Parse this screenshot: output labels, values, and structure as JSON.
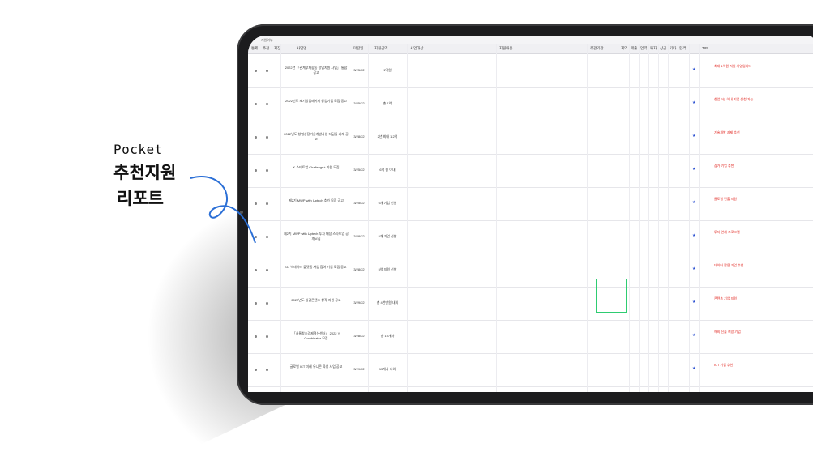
{
  "callout": {
    "line1": "Pocket",
    "line2": "추천지원",
    "line3": "리포트"
  },
  "table": {
    "top_header": "지원여부",
    "columns": [
      "통제",
      "추천",
      "저장",
      "사업명",
      "마감일",
      "지원금액",
      "사업대상",
      "지원내용",
      "주관기관",
      "지역",
      "매출",
      "업력",
      "투자",
      "상금",
      "기타",
      "합격",
      "TIP"
    ],
    "rows": [
      {
        "title": "2022년 「관계부처합동 창업지원 사업」 통합 공고",
        "date": "3/25/22",
        "amount": "1억원",
        "tip": "최대 1억원 지원 사업입니다"
      },
      {
        "title": "2022년도 초기창업패키지 창업기업 모집 공고",
        "date": "3/25/22",
        "amount": "총 1억",
        "tip": "창업 3년 이내 기업 신청 가능"
      },
      {
        "title": "2022년도 창업성장기술개발사업 디딤돌 과제 공고",
        "date": "3/28/22",
        "amount": "2년 최대 1.2억",
        "tip": "기술개발 과제 추천"
      },
      {
        "title": "K-스타트업 Challenge+ 지원 모집",
        "date": "3/25/22",
        "amount": "6억 원 이내",
        "tip": "참가 기업 추천"
      },
      {
        "title": "제2기 MWP with Uptech 추가 모집 공고",
        "date": "3/25/22",
        "amount": "6개 기업 선발",
        "tip": "글로벌 진출 지원"
      },
      {
        "title": "제2기 MWP with Uptech 투자 대상 스타트업 공개모집",
        "date": "3/28/22",
        "amount": "5개 기업 선발",
        "tip": "투자 연계 프로그램"
      },
      {
        "title": "DJ 빅데이터 플랫폼 사업 참여 기업 모집 공고",
        "date": "3/28/22",
        "amount": "5억 지원 선발",
        "tip": "데이터 활용 기업 추천"
      },
      {
        "title": "2022년도 실감콘텐츠 창작 지원 공고",
        "date": "3/29/22",
        "amount": "총 4천만원 내외",
        "tip": "콘텐츠 기업 지원"
      },
      {
        "title": "「서울창조경제혁신센터」 2022 Y Combinator 모집",
        "date": "3/28/22",
        "amount": "총 10개사",
        "tip": "해외 진출 희망 기업"
      },
      {
        "title": "글로벌 ICT 미래 유니콘 육성 사업 공고",
        "date": "3/29/22",
        "amount": "15개사 내외",
        "tip": "ICT 기업 추천"
      }
    ]
  }
}
